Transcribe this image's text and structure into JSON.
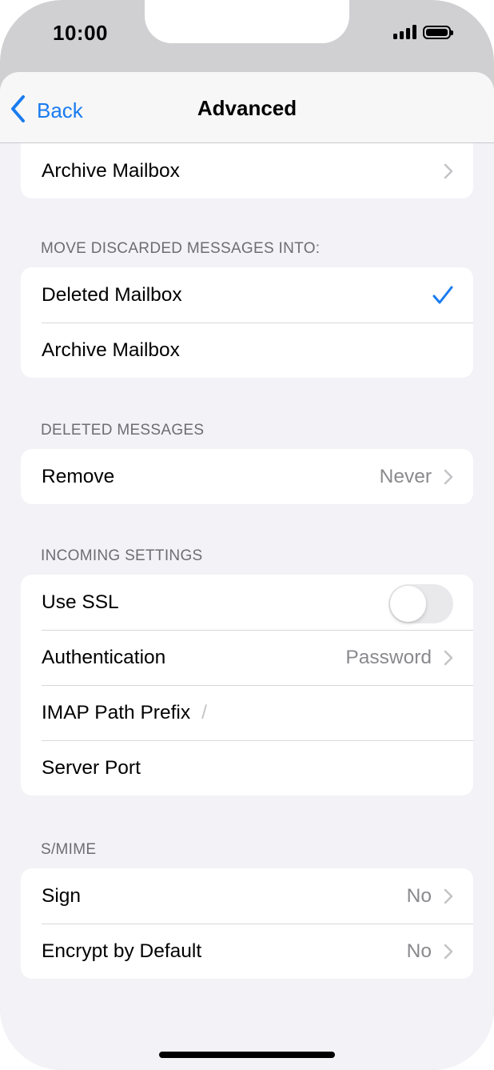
{
  "status_bar": {
    "time": "10:00"
  },
  "nav": {
    "back_label": "Back",
    "title": "Advanced"
  },
  "sections": {
    "top": {
      "rows": [
        {
          "label": "Archive Mailbox"
        }
      ]
    },
    "move_discarded": {
      "header": "MOVE DISCARDED MESSAGES INTO:",
      "rows": [
        {
          "label": "Deleted Mailbox",
          "checked": true
        },
        {
          "label": "Archive Mailbox",
          "checked": false
        }
      ]
    },
    "deleted_messages": {
      "header": "DELETED MESSAGES",
      "rows": [
        {
          "label": "Remove",
          "value": "Never"
        }
      ]
    },
    "incoming": {
      "header": "INCOMING SETTINGS",
      "rows": [
        {
          "label": "Use SSL",
          "toggle_on": false
        },
        {
          "label": "Authentication",
          "value": "Password"
        },
        {
          "label": "IMAP Path Prefix",
          "placeholder": "/"
        },
        {
          "label": "Server Port"
        }
      ]
    },
    "smime": {
      "header": "S/MIME",
      "rows": [
        {
          "label": "Sign",
          "value": "No"
        },
        {
          "label": "Encrypt by Default",
          "value": "No"
        }
      ]
    }
  },
  "colors": {
    "accent": "#1a7cf0",
    "background": "#f2f2f7",
    "secondary_text": "#8a8a8e"
  },
  "icons": {
    "back": "chevron-left-icon",
    "disclosure": "chevron-right-icon",
    "selected": "checkmark-icon"
  }
}
